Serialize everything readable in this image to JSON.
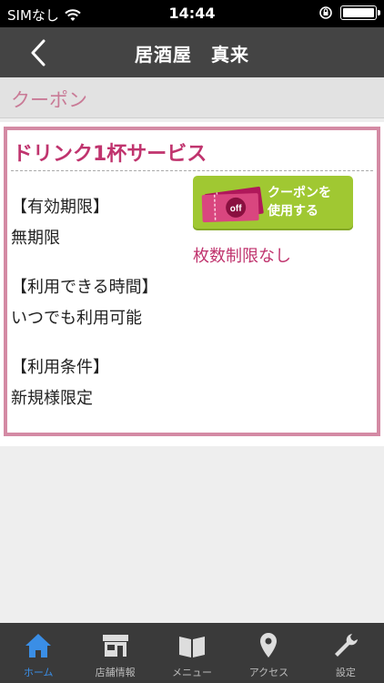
{
  "status_bar": {
    "carrier": "SIMなし",
    "time": "14:44"
  },
  "nav": {
    "title": "居酒屋　真来"
  },
  "section": {
    "title": "クーポン"
  },
  "coupon": {
    "title": "ドリンク1杯サービス",
    "validity_label": "【有効期限】",
    "validity_value": "無期限",
    "time_label": "【利用できる時間】",
    "time_value": "いつでも利用可能",
    "condition_label": "【利用条件】",
    "condition_value": "新規様限定",
    "button_line1": "クーポンを",
    "button_line2": "使用する",
    "ticket_text": "off",
    "limit_text": "枚数制限なし"
  },
  "tabs": [
    {
      "label": "ホーム",
      "icon": "home-icon",
      "active": true
    },
    {
      "label": "店舗情報",
      "icon": "store-icon",
      "active": false
    },
    {
      "label": "メニュー",
      "icon": "menu-book-icon",
      "active": false
    },
    {
      "label": "アクセス",
      "icon": "location-pin-icon",
      "active": false
    },
    {
      "label": "設定",
      "icon": "wrench-icon",
      "active": false
    }
  ],
  "colors": {
    "accent_pink": "#c0346e",
    "border_pink": "#d48aa4",
    "button_green": "#a0c832",
    "tab_active": "#3a8ee6"
  }
}
